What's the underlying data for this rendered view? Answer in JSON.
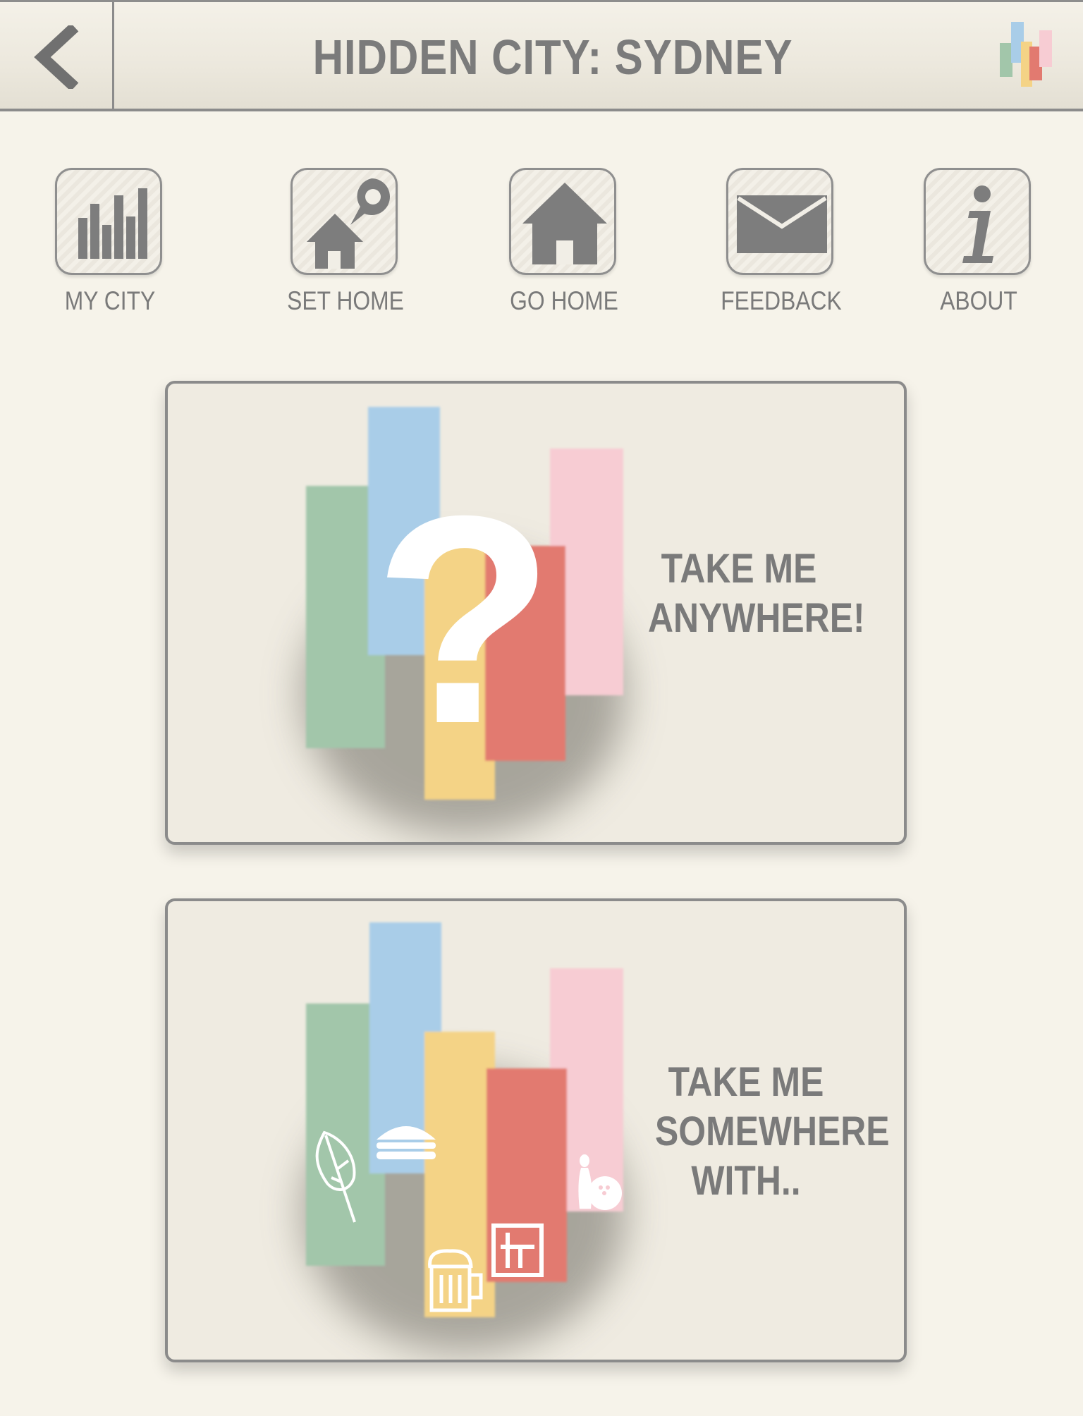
{
  "header": {
    "title": "HIDDEN CITY: SYDNEY",
    "back_icon": "chevron-left-icon",
    "logo": "hidden-city-logo"
  },
  "toolbar": [
    {
      "label": "MY CITY",
      "icon": "bar-chart-icon"
    },
    {
      "label": "SET HOME",
      "icon": "home-pin-icon"
    },
    {
      "label": "GO HOME",
      "icon": "home-icon"
    },
    {
      "label": "FEEDBACK",
      "icon": "envelope-icon"
    },
    {
      "label": "ABOUT",
      "icon": "info-icon"
    }
  ],
  "cards": [
    {
      "label": "TAKE ME ANYWHERE!",
      "icon": "question-mark-icon"
    },
    {
      "label": "TAKE ME SOMEWHERE WITH..",
      "icons": [
        "leaf-icon",
        "burger-icon",
        "beer-icon",
        "art-frame-icon",
        "bowling-icon"
      ]
    }
  ],
  "colors": {
    "green": "#a2c6aa",
    "blue": "#a9cde8",
    "yellow": "#f4d386",
    "red": "#e27a70",
    "pink": "#f7ccd3",
    "text_grey": "#7b7b7b"
  }
}
